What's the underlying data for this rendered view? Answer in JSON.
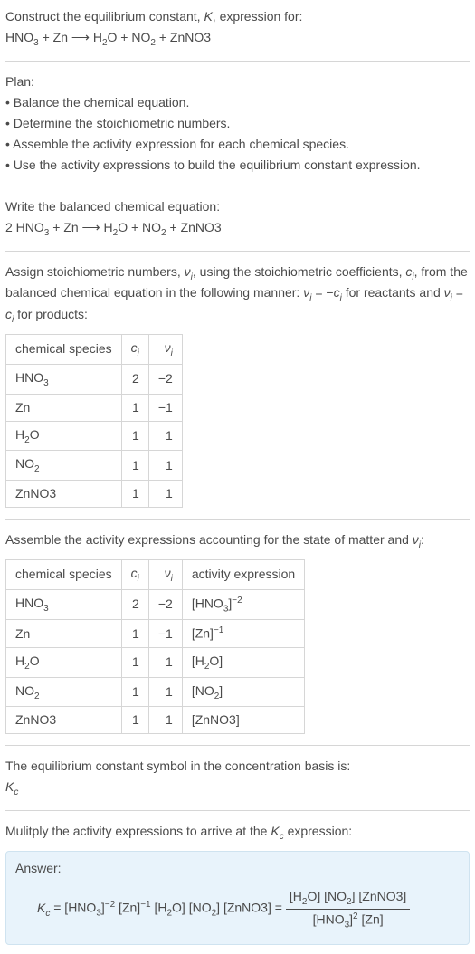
{
  "header": {
    "construct": "Construct the equilibrium constant, K, expression for:",
    "equation": "HNO₃ + Zn ⟶ H₂O + NO₂ + ZnNO3"
  },
  "plan": {
    "title": "Plan:",
    "items": [
      "• Balance the chemical equation.",
      "• Determine the stoichiometric numbers.",
      "• Assemble the activity expression for each chemical species.",
      "• Use the activity expressions to build the equilibrium constant expression."
    ]
  },
  "balanced": {
    "title": "Write the balanced chemical equation:",
    "equation": "2 HNO₃ + Zn ⟶ H₂O + NO₂ + ZnNO3"
  },
  "assign": {
    "text": "Assign stoichiometric numbers, νᵢ, using the stoichiometric coefficients, cᵢ, from the balanced chemical equation in the following manner: νᵢ = −cᵢ for reactants and νᵢ = cᵢ for products:"
  },
  "table1": {
    "head": {
      "species": "chemical species",
      "ci": "cᵢ",
      "vi": "νᵢ"
    },
    "rows": [
      {
        "species": "HNO₃",
        "ci": "2",
        "vi": "−2"
      },
      {
        "species": "Zn",
        "ci": "1",
        "vi": "−1"
      },
      {
        "species": "H₂O",
        "ci": "1",
        "vi": "1"
      },
      {
        "species": "NO₂",
        "ci": "1",
        "vi": "1"
      },
      {
        "species": "ZnNO3",
        "ci": "1",
        "vi": "1"
      }
    ]
  },
  "assemble": {
    "text": "Assemble the activity expressions accounting for the state of matter and νᵢ:"
  },
  "table2": {
    "head": {
      "species": "chemical species",
      "ci": "cᵢ",
      "vi": "νᵢ",
      "act": "activity expression"
    },
    "rows": [
      {
        "species": "HNO₃",
        "ci": "2",
        "vi": "−2",
        "act": "[HNO₃]⁻²"
      },
      {
        "species": "Zn",
        "ci": "1",
        "vi": "−1",
        "act": "[Zn]⁻¹"
      },
      {
        "species": "H₂O",
        "ci": "1",
        "vi": "1",
        "act": "[H₂O]"
      },
      {
        "species": "NO₂",
        "ci": "1",
        "vi": "1",
        "act": "[NO₂]"
      },
      {
        "species": "ZnNO3",
        "ci": "1",
        "vi": "1",
        "act": "[ZnNO3]"
      }
    ]
  },
  "symbol": {
    "text": "The equilibrium constant symbol in the concentration basis is:",
    "kc": "K𝑐"
  },
  "multiply": {
    "text": "Mulitply the activity expressions to arrive at the K𝑐 expression:"
  },
  "answer": {
    "label": "Answer:",
    "lhs": "K𝑐 = [HNO₃]⁻² [Zn]⁻¹ [H₂O] [NO₂] [ZnNO3] = ",
    "frac_top": "[H₂O] [NO₂] [ZnNO3]",
    "frac_bot": "[HNO₃]² [Zn]"
  },
  "chart_data": {
    "type": "table",
    "tables": [
      {
        "title": "Stoichiometric numbers",
        "columns": [
          "chemical species",
          "c_i",
          "ν_i"
        ],
        "rows": [
          [
            "HNO3",
            2,
            -2
          ],
          [
            "Zn",
            1,
            -1
          ],
          [
            "H2O",
            1,
            1
          ],
          [
            "NO2",
            1,
            1
          ],
          [
            "ZnNO3",
            1,
            1
          ]
        ]
      },
      {
        "title": "Activity expressions",
        "columns": [
          "chemical species",
          "c_i",
          "ν_i",
          "activity expression"
        ],
        "rows": [
          [
            "HNO3",
            2,
            -2,
            "[HNO3]^-2"
          ],
          [
            "Zn",
            1,
            -1,
            "[Zn]^-1"
          ],
          [
            "H2O",
            1,
            1,
            "[H2O]"
          ],
          [
            "NO2",
            1,
            1,
            "[NO2]"
          ],
          [
            "ZnNO3",
            1,
            1,
            "[ZnNO3]"
          ]
        ]
      }
    ]
  }
}
